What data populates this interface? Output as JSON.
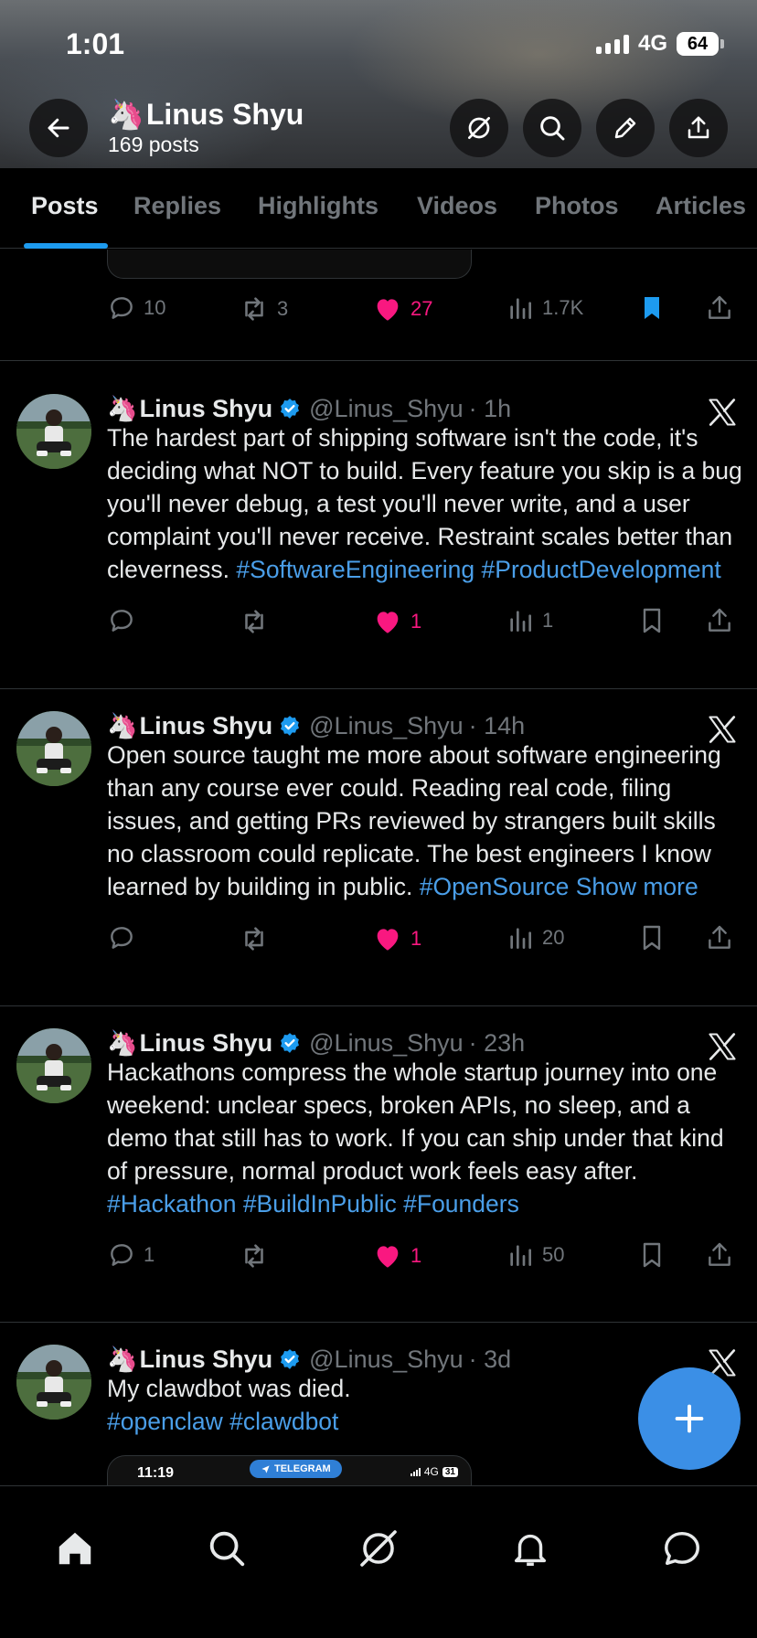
{
  "status_bar": {
    "time": "1:01",
    "network": "4G",
    "battery": "64"
  },
  "profile": {
    "emoji": "🦄",
    "name": "Linus Shyu",
    "post_count": "169 posts"
  },
  "tabs": [
    {
      "label": "Posts",
      "active": true
    },
    {
      "label": "Replies",
      "active": false
    },
    {
      "label": "Highlights",
      "active": false
    },
    {
      "label": "Videos",
      "active": false
    },
    {
      "label": "Photos",
      "active": false
    },
    {
      "label": "Articles",
      "active": false
    }
  ],
  "top_post_actions": {
    "replies": "10",
    "reposts": "3",
    "likes": "27",
    "views": "1.7K",
    "bookmarked": true
  },
  "posts": [
    {
      "name": "Linus Shyu",
      "handle": "@Linus_Shyu",
      "time": "· 1h",
      "text": "The hardest part of shipping software isn't the code, it's deciding what NOT to build. Every feature you skip is a bug you'll never debug, a test you'll never write, and a user complaint you'll never receive. Restraint scales better than cleverness.",
      "hashtags": [
        "#SoftwareEngineering",
        "#ProductDevelopment"
      ],
      "show_more": "",
      "replies": "",
      "reposts": "",
      "likes": "1",
      "views": "1"
    },
    {
      "name": "Linus Shyu",
      "handle": "@Linus_Shyu",
      "time": "· 14h",
      "text": "Open source taught me more about software engineering than any course ever could. Reading real code, filing issues, and getting PRs reviewed by strangers built skills no classroom could replicate. The best engineers I know learned by building in public.",
      "hashtags": [
        "#OpenSource"
      ],
      "show_more": "Show more",
      "replies": "",
      "reposts": "",
      "likes": "1",
      "views": "20"
    },
    {
      "name": "Linus Shyu",
      "handle": "@Linus_Shyu",
      "time": "· 23h",
      "text": "Hackathons compress the whole startup journey into one weekend: unclear specs, broken APIs, no sleep, and a demo that still has to work. If you can ship under that kind of pressure, normal product work feels easy after.",
      "hashtags": [
        "#Hackathon",
        "#BuildInPublic",
        "#Founders"
      ],
      "show_more": "",
      "replies": "1",
      "reposts": "",
      "likes": "1",
      "views": "50"
    },
    {
      "name": "Linus Shyu",
      "handle": "@Linus_Shyu",
      "time": "· 3d",
      "text": "My clawdbot was died.",
      "hashtags": [
        "#openclaw",
        "#clawdbot"
      ],
      "show_more": ""
    }
  ],
  "media_preview": {
    "time": "11:19",
    "app_label": "TELEGRAM",
    "network": "4G",
    "battery": "31"
  },
  "icons": {
    "back": "arrow-left-icon",
    "grok": "grok-icon",
    "search": "search-icon",
    "edit": "pencil-icon",
    "share": "share-icon",
    "reply": "reply-icon",
    "repost": "repost-icon",
    "like": "heart-icon",
    "views": "views-icon",
    "bookmark": "bookmark-icon",
    "verified": "verified-badge-icon",
    "x_logo": "x-logo-icon",
    "compose": "plus-icon",
    "home": "home-icon",
    "notifications": "bell-icon",
    "messages": "message-icon"
  },
  "colors": {
    "background": "#000000",
    "accent": "#1d9bf0",
    "hashtag": "#4a9ee8",
    "like": "#f91880",
    "muted": "#71767b",
    "fab": "#3b8fe6"
  }
}
